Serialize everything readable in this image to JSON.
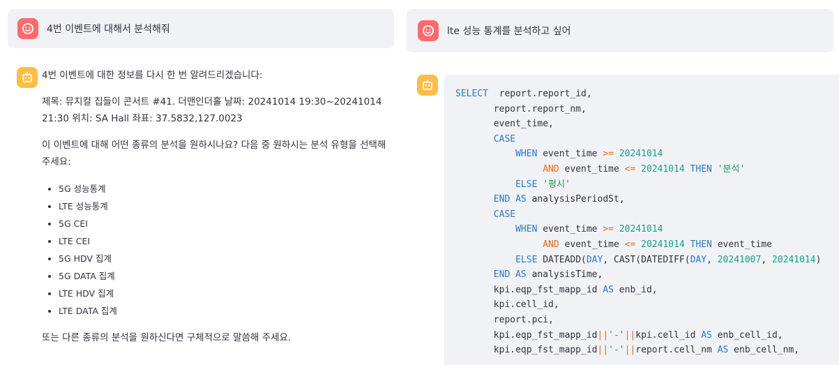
{
  "left_user_message": "4번 이벤트에 대해서 분석해줘",
  "right_user_message": "lte 성능 통계를 분석하고 싶어",
  "bot_message": {
    "intro": "4번 이벤트에 대한 정보를 다시 한 번 알려드리겠습니다:",
    "event_info": "제목: 뮤지컬 집들이 콘서트 #41. 더맨인더홀 날짜: 20241014 19:30~20241014 21:30 위치: SA Hall 좌표: 37.5832,127.0023",
    "question": "이 이벤트에 대해 어떤 종류의 분석을 원하시나요? 다음 중 원하시는 분석 유형을 선택해 주세요:",
    "options": [
      "5G 성능통계",
      "LTE 성능통계",
      "5G CEI",
      "LTE CEI",
      "5G HDV 집계",
      "5G DATA 집계",
      "LTE HDV 집계",
      "LTE DATA 집계"
    ],
    "closing": "또는 다른 종류의 분석을 원하신다면 구체적으로 말씀해 주세요."
  },
  "code_lines": [
    [
      [
        "kw",
        "SELECT"
      ],
      [
        "",
        "  report.report_id,"
      ]
    ],
    [
      [
        "",
        "       report.report_nm,"
      ]
    ],
    [
      [
        "",
        "       event_time,"
      ]
    ],
    [
      [
        "",
        "       "
      ],
      [
        "kw",
        "CASE"
      ]
    ],
    [
      [
        "",
        "           "
      ],
      [
        "kw",
        "WHEN"
      ],
      [
        "",
        " event_time "
      ],
      [
        "or",
        ">="
      ],
      [
        "",
        "",
        " "
      ],
      [
        "num",
        "20241014"
      ]
    ],
    [
      [
        "",
        "                "
      ],
      [
        "or",
        "AND"
      ],
      [
        "",
        " event_time "
      ],
      [
        "or",
        "<="
      ],
      [
        "",
        " "
      ],
      [
        "num",
        "20241014"
      ],
      [
        "",
        " "
      ],
      [
        "kw",
        "THEN"
      ],
      [
        "",
        " "
      ],
      [
        "str",
        "'분석'"
      ]
    ],
    [
      [
        "",
        "           "
      ],
      [
        "kw",
        "ELSE"
      ],
      [
        "",
        " "
      ],
      [
        "str",
        "'평시'"
      ]
    ],
    [
      [
        "",
        "       "
      ],
      [
        "kw",
        "END AS"
      ],
      [
        "",
        " analysisPeriodSt,"
      ]
    ],
    [
      [
        "",
        "       "
      ],
      [
        "kw",
        "CASE"
      ]
    ],
    [
      [
        "",
        "           "
      ],
      [
        "kw",
        "WHEN"
      ],
      [
        "",
        " event_time "
      ],
      [
        "or",
        ">="
      ],
      [
        "",
        " "
      ],
      [
        "num",
        "20241014"
      ]
    ],
    [
      [
        "",
        "                "
      ],
      [
        "or",
        "AND"
      ],
      [
        "",
        " event_time "
      ],
      [
        "or",
        "<="
      ],
      [
        "",
        " "
      ],
      [
        "num",
        "20241014"
      ],
      [
        "",
        " "
      ],
      [
        "kw",
        "THEN"
      ],
      [
        "",
        " event_time"
      ]
    ],
    [
      [
        "",
        "           "
      ],
      [
        "kw",
        "ELSE"
      ],
      [
        "",
        " DATEADD("
      ],
      [
        "kw",
        "DAY"
      ],
      [
        "",
        ", CAST(DATEDIFF("
      ],
      [
        "kw",
        "DAY"
      ],
      [
        "",
        ", "
      ],
      [
        "num",
        "20241007"
      ],
      [
        "",
        ", "
      ],
      [
        "num",
        "20241014"
      ],
      [
        "",
        ")"
      ]
    ],
    [
      [
        "",
        "       "
      ],
      [
        "kw",
        "END AS"
      ],
      [
        "",
        " analysisTime,"
      ]
    ],
    [
      [
        "",
        "       kpi.eqp_fst_mapp_id "
      ],
      [
        "kw",
        "AS"
      ],
      [
        "",
        " enb_id,"
      ]
    ],
    [
      [
        "",
        "       kpi.cell_id,"
      ]
    ],
    [
      [
        "",
        "       report.pci,"
      ]
    ],
    [
      [
        "",
        "       kpi.eqp_fst_mapp_id"
      ],
      [
        "or",
        "||"
      ],
      [
        "str",
        "'-'"
      ],
      [
        "or",
        "||"
      ],
      [
        "",
        "kpi.cell_id "
      ],
      [
        "kw",
        "AS"
      ],
      [
        "",
        " enb_cell_id,"
      ]
    ],
    [
      [
        "",
        "       kpi.eqp_fst_mapp_id"
      ],
      [
        "or",
        "||"
      ],
      [
        "str",
        "'-'"
      ],
      [
        "or",
        "||"
      ],
      [
        "",
        "report.cell_nm "
      ],
      [
        "kw",
        "AS"
      ],
      [
        "",
        " enb_cell_nm,"
      ]
    ]
  ]
}
